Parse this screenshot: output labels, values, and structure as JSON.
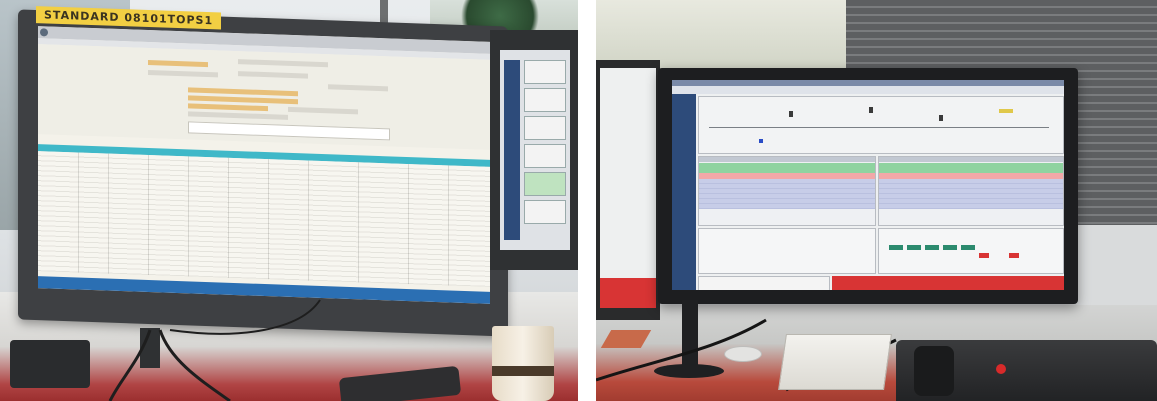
{
  "photos": [
    {
      "name": "left-photo",
      "sticker_text": "STANDARD  08101TOPS1"
    },
    {
      "name": "right-photo"
    }
  ],
  "colors": {
    "table_header_teal": "#3fb8c8",
    "dispatch_green": "#8fd3a0",
    "dispatch_pink": "#f2a8a8",
    "alarm_red": "#d83434",
    "taskbar_blue": "#2b6fb3"
  }
}
